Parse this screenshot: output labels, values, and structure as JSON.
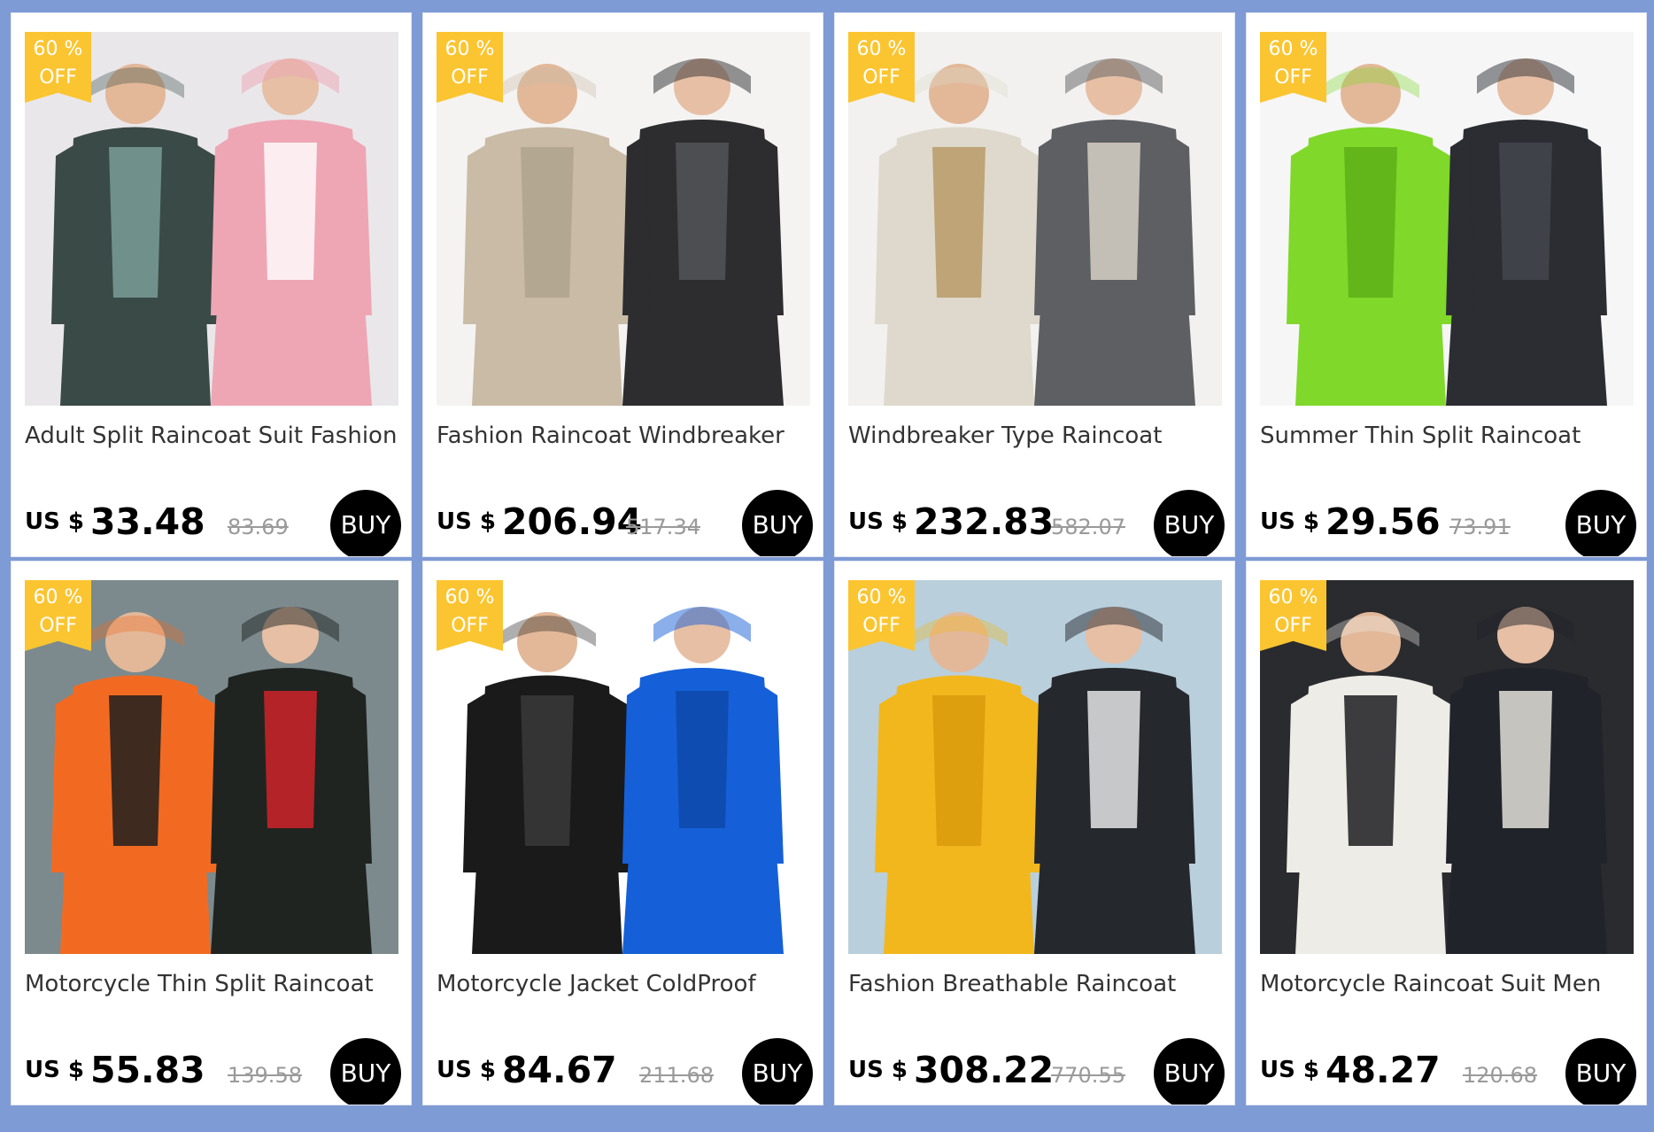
{
  "products": [
    {
      "title": "Adult Split Raincoat Suit Fashion",
      "currency": "US $",
      "price": "33.48",
      "old_price": "83.69",
      "discount_line1": "60 %",
      "discount_line2": "OFF",
      "buy_label": "BUY",
      "colors": {
        "bg": "#e9e7ea",
        "left": "#3a4a46",
        "left_accent": "#7a9c98",
        "right": "#eea6b4",
        "right_accent": "#ffffff"
      }
    },
    {
      "title": "Fashion Raincoat Windbreaker",
      "currency": "US $",
      "price": "206.94",
      "old_price": "517.34",
      "discount_line1": "60 %",
      "discount_line2": "OFF",
      "buy_label": "BUY",
      "colors": {
        "bg": "#f4f3f1",
        "left": "#c9bba5",
        "left_accent": "#b0a38e",
        "right": "#2d2d2f",
        "right_accent": "#55565a"
      }
    },
    {
      "title": "Windbreaker Type Raincoat",
      "currency": "US $",
      "price": "232.83",
      "old_price": "582.07",
      "discount_line1": "60 %",
      "discount_line2": "OFF",
      "buy_label": "BUY",
      "colors": {
        "bg": "#f2f1ef",
        "left": "#ded9cc",
        "left_accent": "#b89a66",
        "right": "#5e5f63",
        "right_accent": "#dcd7ca"
      }
    },
    {
      "title": "Summer Thin Split Raincoat",
      "currency": "US $",
      "price": "29.56",
      "old_price": "73.91",
      "discount_line1": "60 %",
      "discount_line2": "OFF",
      "buy_label": "BUY",
      "colors": {
        "bg": "#f6f6f6",
        "left": "#7fd82a",
        "left_accent": "#5db018",
        "right": "#2b2d33",
        "right_accent": "#45484f"
      }
    },
    {
      "title": "Motorcycle Thin Split Raincoat",
      "currency": "US $",
      "price": "55.83",
      "old_price": "139.58",
      "discount_line1": "60 %",
      "discount_line2": "OFF",
      "buy_label": "BUY",
      "colors": {
        "bg": "#7c8a8e",
        "left": "#f26a22",
        "left_accent": "#1e1e1e",
        "right": "#1f2421",
        "right_accent": "#d8232a"
      }
    },
    {
      "title": "Motorcycle Jacket ColdProof",
      "currency": "US $",
      "price": "84.67",
      "old_price": "211.68",
      "discount_line1": "60 %",
      "discount_line2": "OFF",
      "buy_label": "BUY",
      "colors": {
        "bg": "#ffffff",
        "left": "#1a1a1a",
        "left_accent": "#3a3a3a",
        "right": "#1560d8",
        "right_accent": "#0d47a8"
      }
    },
    {
      "title": "Fashion Breathable Raincoat",
      "currency": "US $",
      "price": "308.22",
      "old_price": "770.55",
      "discount_line1": "60 %",
      "discount_line2": "OFF",
      "buy_label": "BUY",
      "colors": {
        "bg": "#b9cfdc",
        "left": "#f2b71c",
        "left_accent": "#d99b0c",
        "right": "#25282d",
        "right_accent": "#f0f0f0"
      }
    },
    {
      "title": "Motorcycle Raincoat Suit Men",
      "currency": "US $",
      "price": "48.27",
      "old_price": "120.68",
      "discount_line1": "60 %",
      "discount_line2": "OFF",
      "buy_label": "BUY",
      "colors": {
        "bg": "#2a2b2e",
        "left": "#eeece6",
        "left_accent": "#1c1d21",
        "right": "#20232a",
        "right_accent": "#efece3"
      }
    }
  ]
}
